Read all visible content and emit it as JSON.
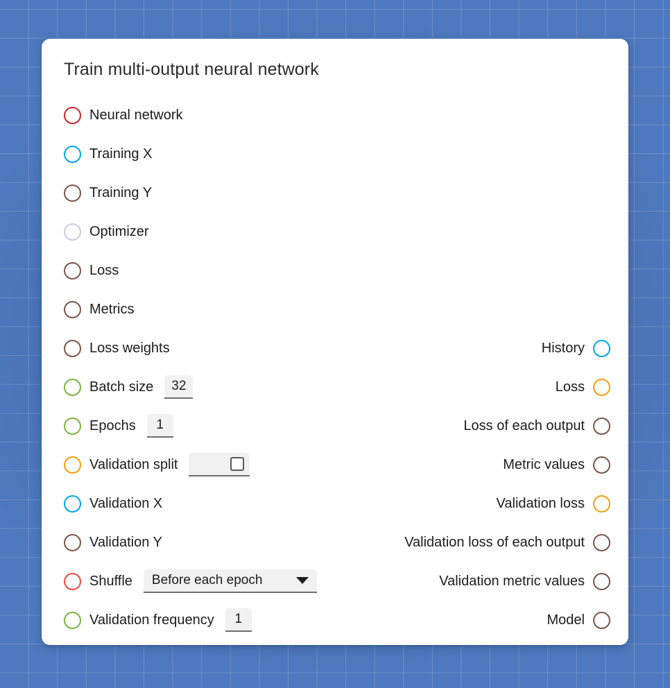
{
  "canvas": {
    "background_color": "#4f79be",
    "grid_line_color": "rgba(255,255,255,0.16)",
    "grid_spacing_px": 41.6
  },
  "node": {
    "title": "Train multi-output neural network",
    "card_color": "#ffffff",
    "inputs": [
      {
        "label": "Neural network",
        "port_color": "#c62828",
        "color_class": "c-darkred",
        "widget": "none"
      },
      {
        "label": "Training X",
        "port_color": "#03a5ef",
        "color_class": "c-blue",
        "widget": "none"
      },
      {
        "label": "Training Y",
        "port_color": "#79554a",
        "color_class": "c-brown",
        "widget": "none"
      },
      {
        "label": "Optimizer",
        "port_color": "#c8cce8",
        "color_class": "c-lavender",
        "widget": "none"
      },
      {
        "label": "Loss",
        "port_color": "#79554a",
        "color_class": "c-brown",
        "widget": "none"
      },
      {
        "label": "Metrics",
        "port_color": "#79554a",
        "color_class": "c-brown",
        "widget": "none"
      },
      {
        "label": "Loss weights",
        "port_color": "#79554a",
        "color_class": "c-brown",
        "widget": "none"
      },
      {
        "label": "Batch size",
        "port_color": "#7cb342",
        "color_class": "c-green",
        "widget": "number",
        "value": "32"
      },
      {
        "label": "Epochs",
        "port_color": "#7cb342",
        "color_class": "c-green",
        "widget": "number",
        "value": "1"
      },
      {
        "label": "Validation split",
        "port_color": "#f99f0b",
        "color_class": "c-orange",
        "widget": "checkbox",
        "value": "",
        "checked": false
      },
      {
        "label": "Validation X",
        "port_color": "#03a5ef",
        "color_class": "c-blue",
        "widget": "none"
      },
      {
        "label": "Validation Y",
        "port_color": "#79554a",
        "color_class": "c-brown",
        "widget": "none"
      },
      {
        "label": "Shuffle",
        "port_color": "#f4463a",
        "color_class": "c-red",
        "widget": "dropdown",
        "value": "Before each epoch",
        "options": [
          "Before each epoch"
        ]
      },
      {
        "label": "Validation frequency",
        "port_color": "#7cb342",
        "color_class": "c-green",
        "widget": "number",
        "value": "1"
      }
    ],
    "outputs": [
      {
        "label": "History",
        "port_color": "#03a5ef",
        "color_class": "c-blue"
      },
      {
        "label": "Loss",
        "port_color": "#f99f0b",
        "color_class": "c-orange"
      },
      {
        "label": "Loss of each output",
        "port_color": "#79554a",
        "color_class": "c-brown"
      },
      {
        "label": "Metric values",
        "port_color": "#79554a",
        "color_class": "c-brown"
      },
      {
        "label": "Validation loss",
        "port_color": "#f99f0b",
        "color_class": "c-orange"
      },
      {
        "label": "Validation loss of each output",
        "port_color": "#79554a",
        "color_class": "c-brown"
      },
      {
        "label": "Validation metric values",
        "port_color": "#79554a",
        "color_class": "c-brown"
      },
      {
        "label": "Model",
        "port_color": "#79554a",
        "color_class": "c-brown"
      }
    ]
  }
}
